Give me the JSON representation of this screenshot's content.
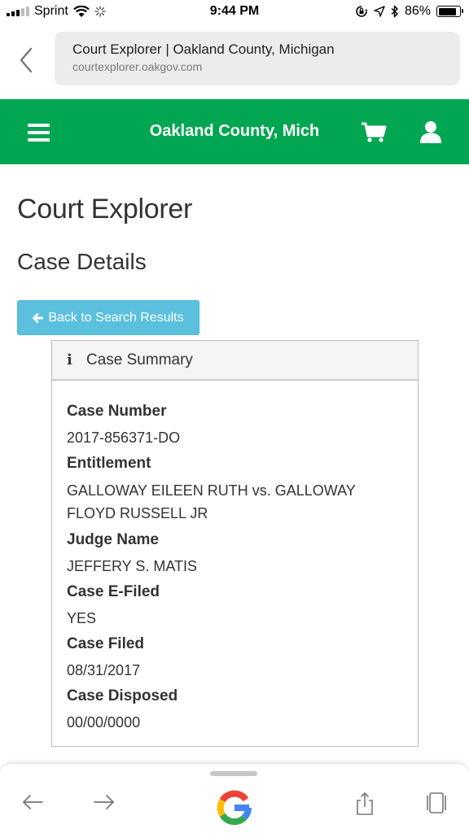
{
  "status_bar": {
    "carrier": "Sprint",
    "time": "9:44 PM",
    "battery": "86%",
    "battery_level": 0.86
  },
  "browser": {
    "page_title": "Court Explorer | Oakland County, Michigan",
    "domain": "courtexplorer.oakgov.com"
  },
  "header": {
    "title": "Oakland County, Mich",
    "brand_color": "#00a651"
  },
  "page": {
    "title": "Court Explorer",
    "section": "Case Details",
    "back_button": "Back to Search Results"
  },
  "summary": {
    "heading": "Case Summary",
    "fields": [
      {
        "label": "Case Number",
        "value": "2017-856371-DO"
      },
      {
        "label": "Entitlement",
        "value": "GALLOWAY EILEEN RUTH vs. GALLOWAY FLOYD RUSSELL JR"
      },
      {
        "label": "Judge Name",
        "value": "JEFFERY S. MATIS"
      },
      {
        "label": "Case E-Filed",
        "value": "YES"
      },
      {
        "label": "Case Filed",
        "value": "08/31/2017"
      },
      {
        "label": "Case Disposed",
        "value": "00/00/0000"
      }
    ]
  },
  "toolbar": {
    "icons": [
      "back-arrow-icon",
      "forward-arrow-icon",
      "google-icon",
      "share-icon",
      "tabs-icon"
    ]
  }
}
